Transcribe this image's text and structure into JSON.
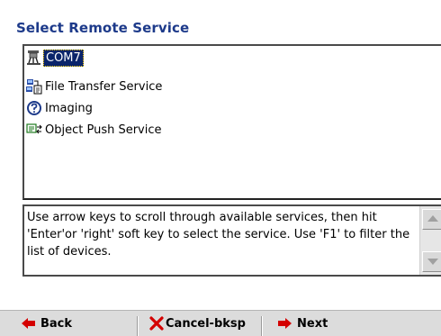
{
  "title": "Select Remote Service",
  "services": [
    {
      "label": "COM7",
      "icon": "serial-port-icon",
      "selected": true
    },
    {
      "label": "File Transfer Service",
      "icon": "file-transfer-icon",
      "selected": false
    },
    {
      "label": "Imaging",
      "icon": "imaging-icon",
      "selected": false
    },
    {
      "label": "Object Push Service",
      "icon": "object-push-icon",
      "selected": false
    }
  ],
  "help_text": "Use arrow keys to scroll through available services, then hit 'Enter'or 'right' soft key to select the service. Use 'F1' to filter the list of devices.",
  "softkeys": {
    "back": "Back",
    "cancel": "Cancel-bksp",
    "next": "Next"
  },
  "colors": {
    "title": "#1d3a8a",
    "selection": "#0a246a",
    "arrow_red": "#d40000",
    "softkey_bar": "#dcdcdc"
  }
}
